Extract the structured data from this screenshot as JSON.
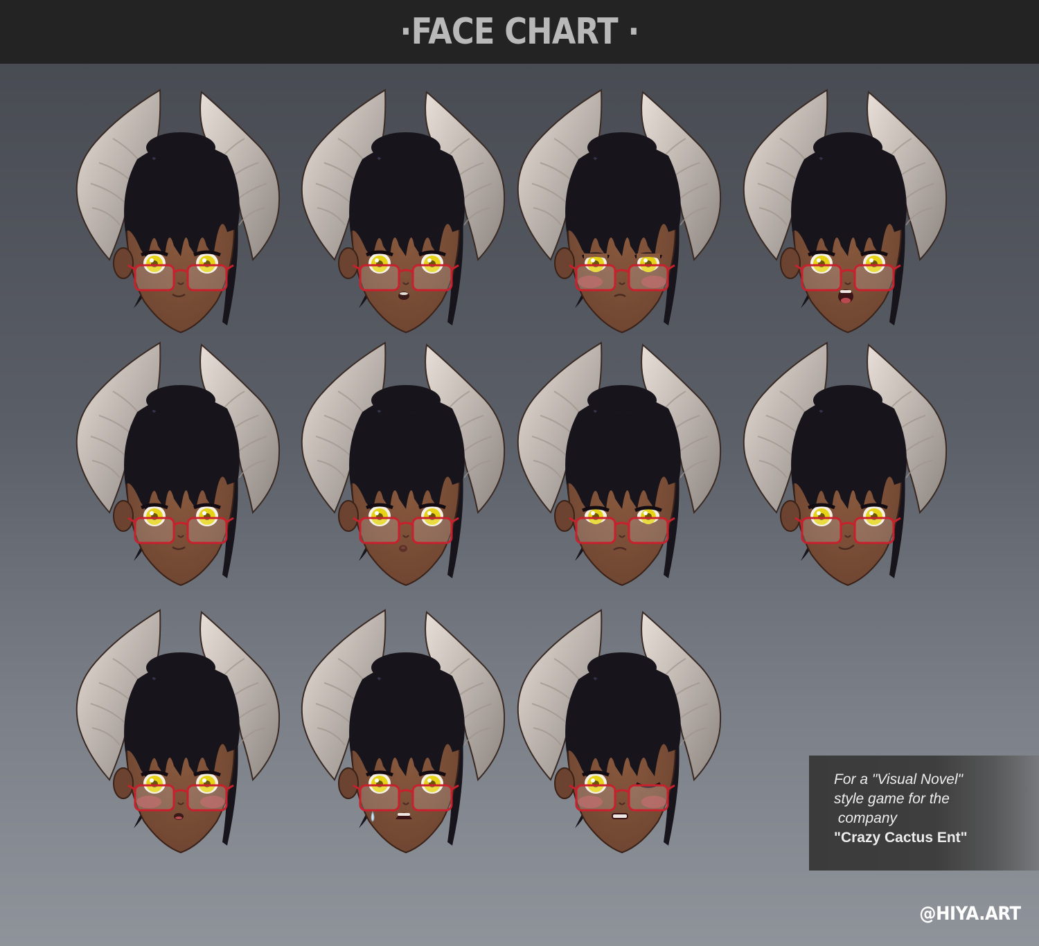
{
  "header": {
    "title": "·FACE CHART ·"
  },
  "faces": [
    {
      "expression": "smile",
      "blush": false,
      "eyes": "open",
      "sweat": false
    },
    {
      "expression": "surprised",
      "blush": false,
      "eyes": "open",
      "sweat": false
    },
    {
      "expression": "pout-blush",
      "blush": true,
      "eyes": "half",
      "sweat": false
    },
    {
      "expression": "shocked",
      "blush": false,
      "eyes": "open",
      "sweat": false
    },
    {
      "expression": "smile",
      "blush": false,
      "eyes": "open",
      "sweat": false
    },
    {
      "expression": "pucker",
      "blush": false,
      "eyes": "open",
      "sweat": false
    },
    {
      "expression": "frown",
      "blush": false,
      "eyes": "narrow",
      "sweat": false
    },
    {
      "expression": "smirk",
      "blush": false,
      "eyes": "open",
      "sweat": false
    },
    {
      "expression": "flustered",
      "blush": true,
      "eyes": "open",
      "sweat": false
    },
    {
      "expression": "upset",
      "blush": false,
      "eyes": "open",
      "sweat": true
    },
    {
      "expression": "wink-grimace",
      "blush": true,
      "eyes": "wink",
      "sweat": false
    }
  ],
  "colors": {
    "horn_light": "#e8e0d8",
    "horn_dark": "#8d8580",
    "hair": "#17141b",
    "skin": "#8a5a3e",
    "skin_shadow": "#6b4330",
    "iris": "#e6d318",
    "glasses": "#c8202c",
    "blush": "#c94f55"
  },
  "caption": {
    "line1": "For a \"Visual Novel\"",
    "line2": "style game for the",
    "line3": " company",
    "line4": "\"Crazy Cactus Ent\""
  },
  "credit": "@HIYA.ART"
}
